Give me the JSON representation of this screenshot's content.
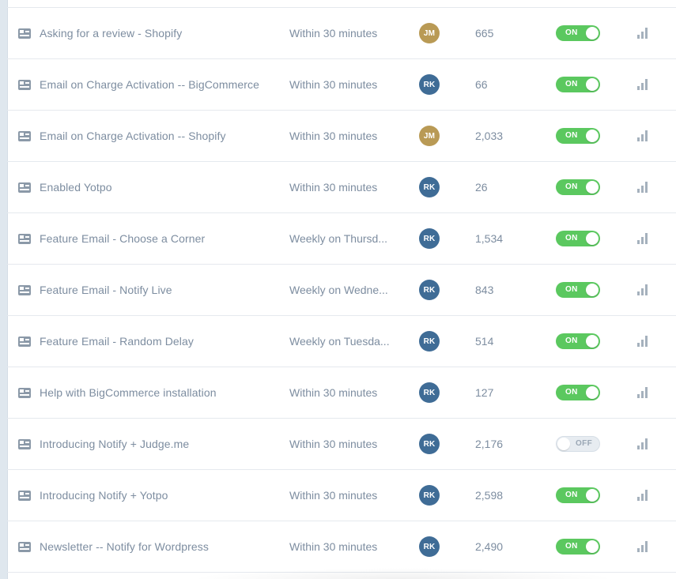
{
  "rows": [
    {
      "name": "Asking for a review - Shopify",
      "schedule": "Within 30 minutes",
      "owner": "JM",
      "owner_color": "#b99a55",
      "count": "665",
      "status": "ON"
    },
    {
      "name": "Email on Charge Activation -- BigCommerce",
      "schedule": "Within 30 minutes",
      "owner": "RK",
      "owner_color": "#3f6c96",
      "count": "66",
      "status": "ON"
    },
    {
      "name": "Email on Charge Activation -- Shopify",
      "schedule": "Within 30 minutes",
      "owner": "JM",
      "owner_color": "#b99a55",
      "count": "2,033",
      "status": "ON"
    },
    {
      "name": "Enabled Yotpo",
      "schedule": "Within 30 minutes",
      "owner": "RK",
      "owner_color": "#3f6c96",
      "count": "26",
      "status": "ON"
    },
    {
      "name": "Feature Email - Choose a Corner",
      "schedule": "Weekly on Thursd...",
      "owner": "RK",
      "owner_color": "#3f6c96",
      "count": "1,534",
      "status": "ON"
    },
    {
      "name": "Feature Email - Notify Live",
      "schedule": "Weekly on Wedne...",
      "owner": "RK",
      "owner_color": "#3f6c96",
      "count": "843",
      "status": "ON"
    },
    {
      "name": "Feature Email - Random Delay",
      "schedule": "Weekly on Tuesda...",
      "owner": "RK",
      "owner_color": "#3f6c96",
      "count": "514",
      "status": "ON"
    },
    {
      "name": "Help with BigCommerce installation",
      "schedule": "Within 30 minutes",
      "owner": "RK",
      "owner_color": "#3f6c96",
      "count": "127",
      "status": "ON"
    },
    {
      "name": "Introducing Notify + Judge.me",
      "schedule": "Within 30 minutes",
      "owner": "RK",
      "owner_color": "#3f6c96",
      "count": "2,176",
      "status": "OFF"
    },
    {
      "name": "Introducing Notify + Yotpo",
      "schedule": "Within 30 minutes",
      "owner": "RK",
      "owner_color": "#3f6c96",
      "count": "2,598",
      "status": "ON"
    },
    {
      "name": "Newsletter -- Notify for Wordpress",
      "schedule": "Within 30 minutes",
      "owner": "RK",
      "owner_color": "#3f6c96",
      "count": "2,490",
      "status": "ON"
    }
  ],
  "icons": {
    "row_type": "email-template-icon",
    "stats": "bar-chart-icon"
  },
  "colors": {
    "toggle_on": "#5bc85f",
    "toggle_off": "#e7ecf1",
    "text": "#7d8da0"
  }
}
